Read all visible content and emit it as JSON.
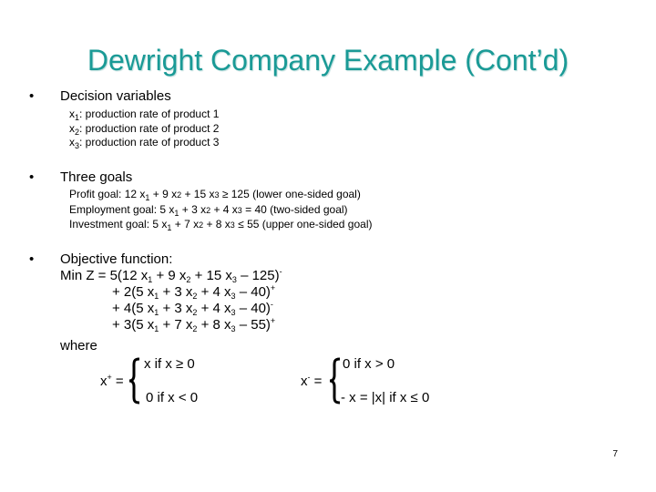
{
  "title": "Dewright Company Example (Cont’d)",
  "bullet_glyph": "•",
  "sections": {
    "decision": {
      "heading": "Decision variables",
      "items": [
        {
          "var": "x",
          "sub": "1",
          "text": ": production rate of product 1"
        },
        {
          "var": "x",
          "sub": "2",
          "text": ": production rate of product 2"
        },
        {
          "var": "x",
          "sub": "3",
          "text": ": production rate of product 3"
        }
      ]
    },
    "goals": {
      "heading": "Three goals",
      "items": [
        {
          "label": "Profit goal: 12 x",
          "s1": "1",
          "mid1": " + 9 x",
          "s2": "2",
          "mid2": " + 15 x",
          "s3": "3",
          "rest": " ≥ 125 (lower one-sided goal)"
        },
        {
          "label": "Employment goal: 5 x",
          "s1": "1",
          "mid1": " + 3 x",
          "s2": "2",
          "mid2": " + 4 x",
          "s3": "3",
          "rest": " = 40 (two-sided goal)"
        },
        {
          "label": "Investment goal: 5 x",
          "s1": "1",
          "mid1": " + 7 x",
          "s2": "2",
          "mid2": " + 8 x",
          "s3": "3",
          "rest": " ≤ 55 (upper one-sided goal)"
        }
      ]
    },
    "objective": {
      "heading": "Objective function:",
      "lines": [
        {
          "a": "Min Z = 5(12 x",
          "b": " + 9 x",
          "c": " + 15 x",
          "d": " – 125)",
          "sup": "-"
        },
        {
          "a": "+ 2(5 x",
          "b": " + 3 x",
          "c": " + 4 x",
          "d": " – 40)",
          "sup": "+"
        },
        {
          "a": "+ 4(5 x",
          "b": " + 3 x",
          "c": " + 4 x",
          "d": " – 40)",
          "sup": "-"
        },
        {
          "a": "+ 3(5 x",
          "b": " + 7 x",
          "c": " + 8 x",
          "d": " – 55)",
          "sup": "+"
        }
      ],
      "where": "where"
    },
    "xplus": {
      "lhs": "x",
      "sup": "+",
      "eq": " =",
      "case1": "x if x ≥ 0",
      "case2": "0  if x < 0"
    },
    "xminus": {
      "lhs": "x",
      "sup": "-",
      "eq": " =",
      "case1": "0  if x > 0",
      "case2": "- x = |x|  if x ≤ 0"
    }
  },
  "page_number": "7",
  "colors": {
    "title": "#1a9a96"
  }
}
